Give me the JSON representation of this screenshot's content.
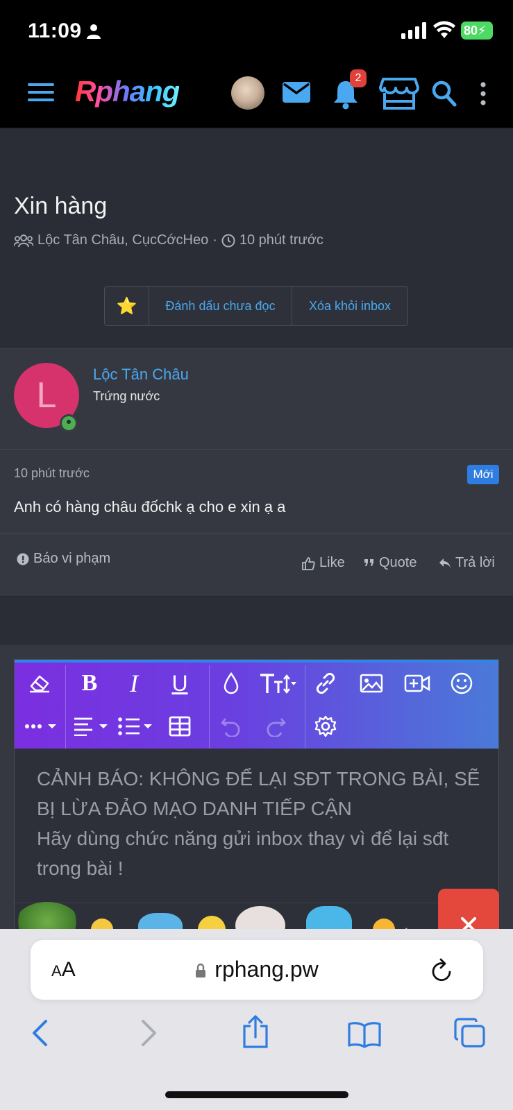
{
  "status_bar": {
    "time": "11:09",
    "battery": "80"
  },
  "header": {
    "logo": "Rphang",
    "notification_count": "2"
  },
  "thread": {
    "title": "Xin hàng",
    "participants": "Lộc Tân Châu, CụcCớcHeo",
    "separator": "·",
    "time": "10 phút trước",
    "actions": {
      "star": "⭐",
      "mark_unread": "Đánh dấu chưa đọc",
      "remove": "Xóa khỏi inbox"
    }
  },
  "message": {
    "author": "Lộc Tân Châu",
    "author_initial": "L",
    "author_title": "Trứng nước",
    "time": "10 phút trước",
    "new_badge": "Mới",
    "text": "Anh có hàng châu đốchk ạ cho e xin ạ a",
    "report": "Báo vi phạm",
    "like": "Like",
    "quote": "Quote",
    "reply": "Trả lời"
  },
  "editor": {
    "warning_line1": "CẢNH BÁO: KHÔNG ĐỂ LẠI SĐT TRONG BÀI, SẼ BỊ LỪA ĐẢO MẠO DANH TIẾP CẬN",
    "warning_line2": "Hãy dùng chức năng gửi inbox thay vì để lại sđt trong bài !"
  },
  "safari": {
    "aa_small": "A",
    "aa_large": "A",
    "url": "rphang.pw"
  }
}
